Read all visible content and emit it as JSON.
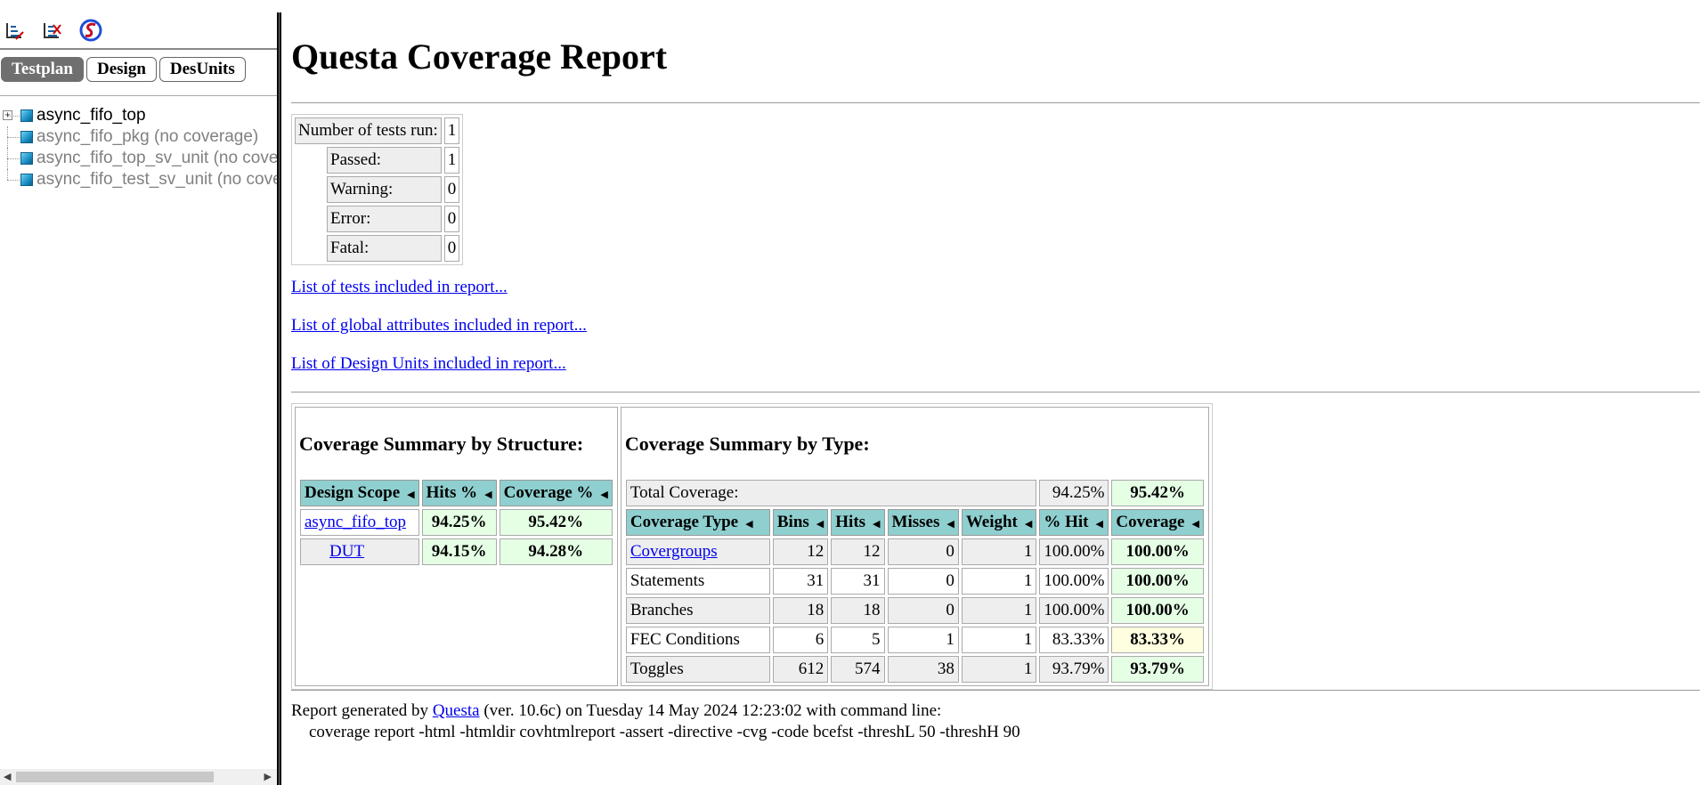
{
  "left": {
    "toolbar": [
      {
        "name": "expand-all-icon"
      },
      {
        "name": "collapse-all-icon"
      },
      {
        "name": "questa-logo-icon"
      }
    ],
    "tabs": [
      "Testplan",
      "Design",
      "DesUnits"
    ],
    "active_tab": "Testplan",
    "tree": [
      {
        "label": "async_fifo_top",
        "dim": false,
        "expandable": true
      },
      {
        "label": "async_fifo_pkg (no coverage)",
        "dim": true,
        "expandable": false
      },
      {
        "label": "async_fifo_top_sv_unit (no coverage)",
        "dim": true,
        "expandable": false
      },
      {
        "label": "async_fifo_test_sv_unit (no coverage)",
        "dim": true,
        "expandable": false
      }
    ]
  },
  "main": {
    "title": "Questa Coverage Report",
    "tests": {
      "number_label": "Number of tests run:",
      "number": "1",
      "passed_label": "Passed:",
      "passed": "1",
      "warning_label": "Warning:",
      "warning": "0",
      "error_label": "Error:",
      "error": "0",
      "fatal_label": "Fatal:",
      "fatal": "0"
    },
    "links": {
      "tests": "List of tests included in report...",
      "attributes": "List of global attributes included in report...",
      "design_units": "List of Design Units included in report..."
    },
    "structure": {
      "heading": "Coverage Summary by Structure:",
      "headers": [
        "Design Scope",
        "Hits %",
        "Coverage %"
      ],
      "rows": [
        {
          "scope": "async_fifo_top",
          "hits": "94.25%",
          "coverage": "95.42%"
        },
        {
          "scope": "DUT",
          "hits": "94.15%",
          "coverage": "94.28%"
        }
      ]
    },
    "type": {
      "heading": "Coverage Summary by Type:",
      "total_label": "Total Coverage:",
      "total_hit": "94.25%",
      "total_cov": "95.42%",
      "headers": [
        "Coverage Type",
        "Bins",
        "Hits",
        "Misses",
        "Weight",
        "% Hit",
        "Coverage"
      ],
      "rows": [
        {
          "type": "Covergroups",
          "bins": "12",
          "hits": "12",
          "misses": "0",
          "weight": "1",
          "hit": "100.00%",
          "coverage": "100.00%"
        },
        {
          "type": "Statements",
          "bins": "31",
          "hits": "31",
          "misses": "0",
          "weight": "1",
          "hit": "100.00%",
          "coverage": "100.00%"
        },
        {
          "type": "Branches",
          "bins": "18",
          "hits": "18",
          "misses": "0",
          "weight": "1",
          "hit": "100.00%",
          "coverage": "100.00%"
        },
        {
          "type": "FEC Conditions",
          "bins": "6",
          "hits": "5",
          "misses": "1",
          "weight": "1",
          "hit": "83.33%",
          "coverage": "83.33%"
        },
        {
          "type": "Toggles",
          "bins": "612",
          "hits": "574",
          "misses": "38",
          "weight": "1",
          "hit": "93.79%",
          "coverage": "93.79%"
        }
      ]
    },
    "footer": {
      "prefix": "Report generated by ",
      "tool": "Questa",
      "suffix": " (ver. 10.6c) on Tuesday 14 May 2024 12:23:02 with command line:",
      "command": "coverage report -html -htmldir covhtmlreport -assert -directive -cvg -code bcefst -threshL 50 -threshH 90"
    }
  },
  "colors": {
    "header_teal": "#8fcfcf",
    "good_green": "#e5ffe5",
    "mid_yellow": "#ffffe0",
    "link_blue": "#0000ee",
    "active_tab": "#6f6f6f"
  }
}
